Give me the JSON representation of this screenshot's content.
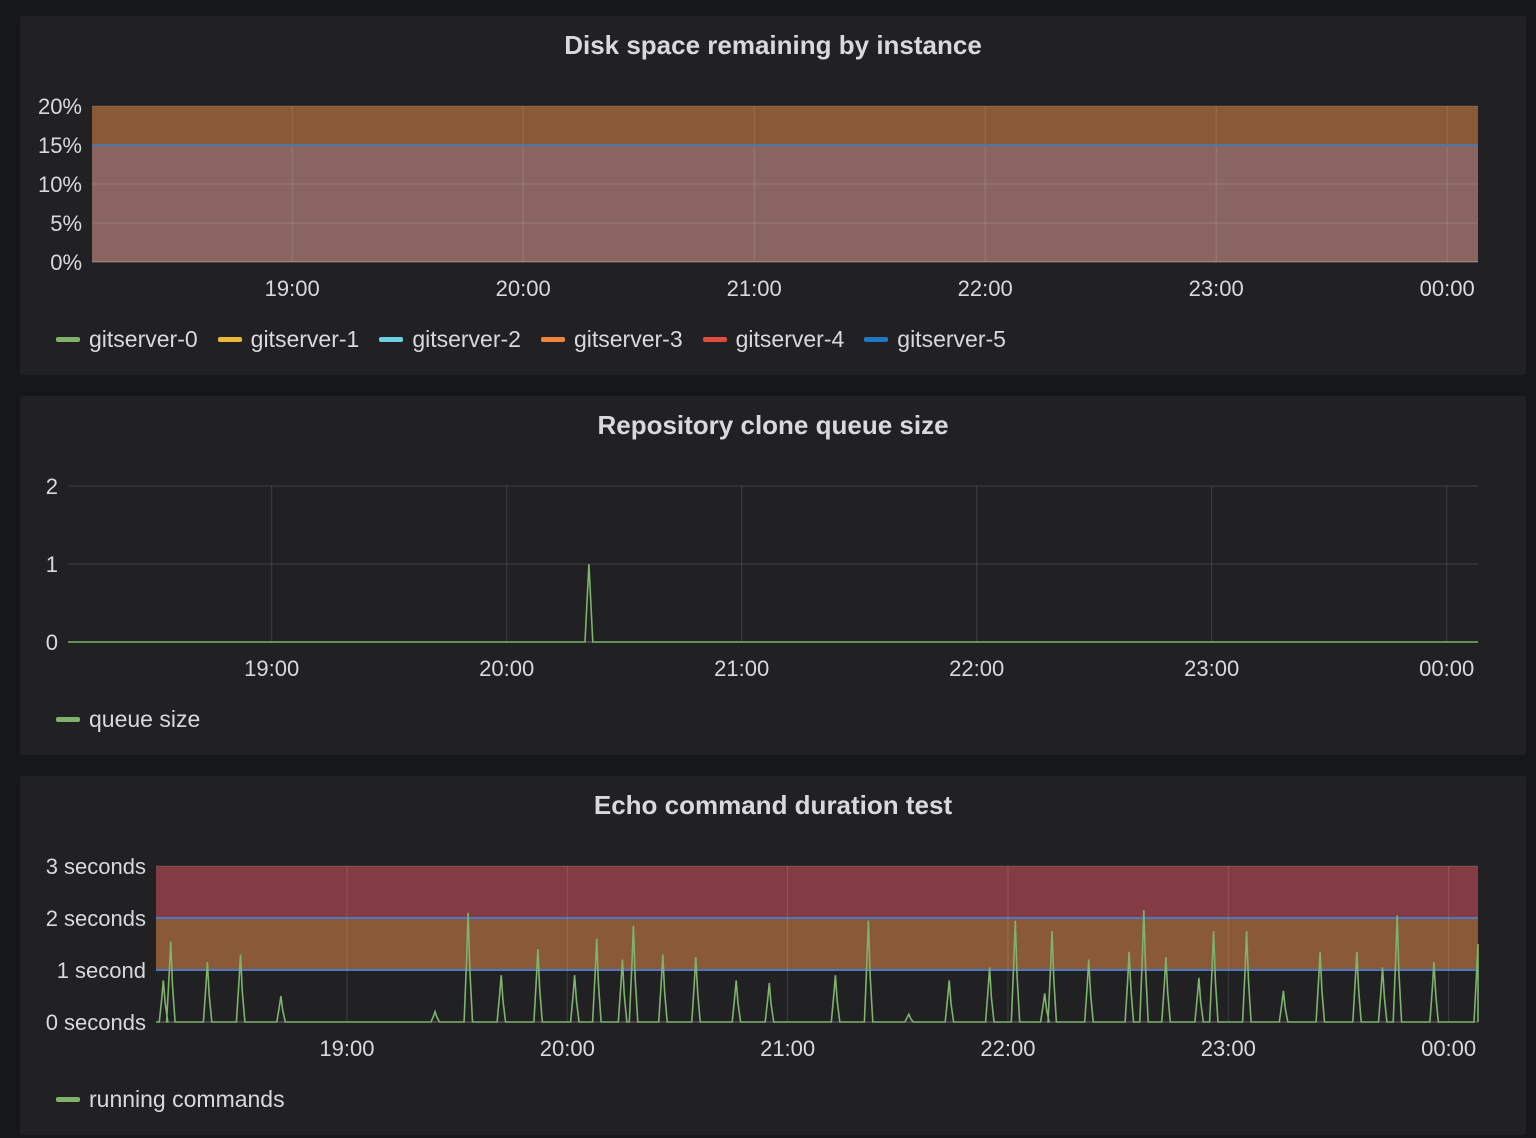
{
  "chart_data": [
    {
      "type": "area",
      "title": "Disk space remaining by instance",
      "x_ticks": [
        "19:00",
        "20:00",
        "21:00",
        "22:00",
        "23:00",
        "00:00"
      ],
      "y_ticks": [
        "0%",
        "5%",
        "10%",
        "15%",
        "20%"
      ],
      "ylim": [
        0,
        20
      ],
      "xlim": [
        "18:08",
        "00:08"
      ],
      "grid": true,
      "thresholds": [
        {
          "from": 15,
          "to": 20,
          "color": "#895a35"
        },
        {
          "from": 0,
          "to": 15,
          "color": "#8a6461"
        }
      ],
      "series": [
        {
          "name": "gitserver-0",
          "color": "#7eb26d",
          "value": 15
        },
        {
          "name": "gitserver-1",
          "color": "#eab839",
          "value": 15
        },
        {
          "name": "gitserver-2",
          "color": "#6ed0e0",
          "value": 15
        },
        {
          "name": "gitserver-3",
          "color": "#ef843c",
          "value": 15
        },
        {
          "name": "gitserver-4",
          "color": "#e24d42",
          "value": 15
        },
        {
          "name": "gitserver-5",
          "color": "#1f78c1",
          "value": 15
        }
      ],
      "legend_position": "bottom-left"
    },
    {
      "type": "line",
      "title": "Repository clone queue size",
      "x_ticks": [
        "19:00",
        "20:00",
        "21:00",
        "22:00",
        "23:00",
        "00:00"
      ],
      "y_ticks": [
        "0",
        "1",
        "2"
      ],
      "ylim": [
        0,
        2
      ],
      "xlim": [
        "18:08",
        "00:08"
      ],
      "grid": true,
      "series": [
        {
          "name": "queue size",
          "color": "#7eb26d",
          "x": [
            "18:08",
            "20:20",
            "20:21",
            "20:22",
            "00:08"
          ],
          "values": [
            0,
            0,
            1,
            0,
            0
          ]
        }
      ],
      "legend_position": "bottom-left"
    },
    {
      "type": "line",
      "title": "Echo command duration test",
      "x_ticks": [
        "19:00",
        "20:00",
        "21:00",
        "22:00",
        "23:00",
        "00:00"
      ],
      "y_ticks": [
        "0 seconds",
        "1 second",
        "2 seconds",
        "3 seconds"
      ],
      "ylim": [
        0,
        3
      ],
      "xlim": [
        "18:08",
        "00:08"
      ],
      "grid": true,
      "thresholds": [
        {
          "from": 2,
          "to": 3,
          "color": "#833b44"
        },
        {
          "from": 1,
          "to": 2,
          "color": "#895a35"
        }
      ],
      "series": [
        {
          "name": "running commands",
          "color": "#7eb26d",
          "spikes": [
            {
              "t": "18:10",
              "v": 0.8
            },
            {
              "t": "18:12",
              "v": 1.55
            },
            {
              "t": "18:22",
              "v": 1.15
            },
            {
              "t": "18:31",
              "v": 1.3
            },
            {
              "t": "18:42",
              "v": 0.5
            },
            {
              "t": "19:24",
              "v": 0.2
            },
            {
              "t": "19:33",
              "v": 2.1
            },
            {
              "t": "19:42",
              "v": 0.9
            },
            {
              "t": "19:52",
              "v": 1.4
            },
            {
              "t": "20:02",
              "v": 0.9
            },
            {
              "t": "20:08",
              "v": 1.6
            },
            {
              "t": "20:15",
              "v": 1.2
            },
            {
              "t": "20:18",
              "v": 1.85
            },
            {
              "t": "20:26",
              "v": 1.3
            },
            {
              "t": "20:35",
              "v": 1.25
            },
            {
              "t": "20:46",
              "v": 0.8
            },
            {
              "t": "20:55",
              "v": 0.75
            },
            {
              "t": "21:13",
              "v": 0.9
            },
            {
              "t": "21:22",
              "v": 1.95
            },
            {
              "t": "21:33",
              "v": 0.15
            },
            {
              "t": "21:44",
              "v": 0.8
            },
            {
              "t": "21:55",
              "v": 1.05
            },
            {
              "t": "22:02",
              "v": 1.95
            },
            {
              "t": "22:10",
              "v": 0.55
            },
            {
              "t": "22:12",
              "v": 1.75
            },
            {
              "t": "22:22",
              "v": 1.2
            },
            {
              "t": "22:33",
              "v": 1.35
            },
            {
              "t": "22:37",
              "v": 2.15
            },
            {
              "t": "22:43",
              "v": 1.25
            },
            {
              "t": "22:52",
              "v": 0.85
            },
            {
              "t": "22:56",
              "v": 1.75
            },
            {
              "t": "23:05",
              "v": 1.75
            },
            {
              "t": "23:15",
              "v": 0.6
            },
            {
              "t": "23:25",
              "v": 1.35
            },
            {
              "t": "23:35",
              "v": 1.35
            },
            {
              "t": "23:42",
              "v": 1.05
            },
            {
              "t": "23:46",
              "v": 2.05
            },
            {
              "t": "23:56",
              "v": 1.15
            },
            {
              "t": "00:08",
              "v": 1.5
            }
          ]
        }
      ],
      "legend_position": "bottom-left"
    }
  ]
}
